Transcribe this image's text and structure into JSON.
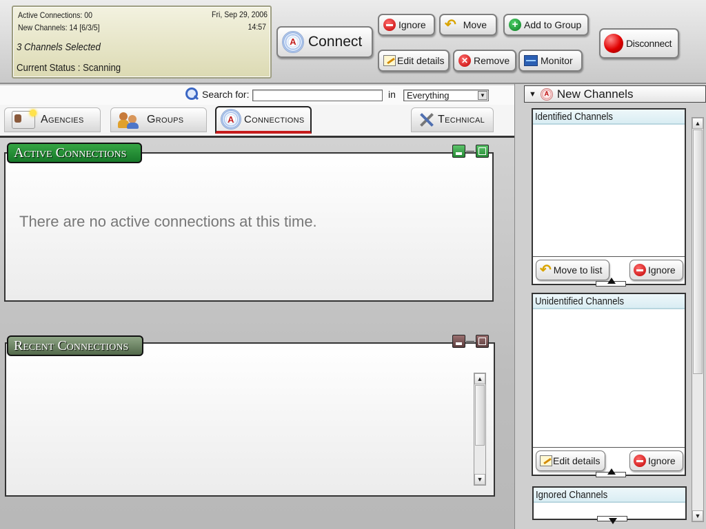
{
  "status": {
    "active_connections": "Active Connections: 00",
    "new_channels": "New Channels: 14 [6/3/5]",
    "date": "Fri, Sep 29, 2006",
    "time": "14:57",
    "channels_selected": "3 Channels Selected",
    "current_status": "Current Status : Scanning"
  },
  "toolbar": {
    "connect": "Connect",
    "ignore": "Ignore",
    "move": "Move",
    "add_to_group": "Add to Group",
    "edit_details": "Edit details",
    "remove": "Remove",
    "monitor": "Monitor",
    "disconnect": "Disconnect"
  },
  "search": {
    "label": "Search for:",
    "value": "",
    "in_label": "in",
    "scope": "Everything"
  },
  "tabs": [
    {
      "label": "Agencies",
      "icon": "id-card-icon"
    },
    {
      "label": "Groups",
      "icon": "people-icon"
    },
    {
      "label": "Connections",
      "icon": "antenna-icon",
      "active": true
    },
    {
      "label": "Technical",
      "icon": "tools-icon"
    }
  ],
  "active_connections": {
    "title": "Active Connections",
    "empty_message": "There are no active connections at this time.",
    "accent": "#1f8f2f"
  },
  "recent_connections": {
    "title": "Recent Connections",
    "accent": "#5a7a52"
  },
  "new_channels": {
    "title": "New Channels",
    "identified": {
      "title": "Identified Channels",
      "move_to_list": "Move to list",
      "ignore": "Ignore"
    },
    "unidentified": {
      "title": "Unidentified Channels",
      "edit_details": "Edit details",
      "ignore": "Ignore"
    },
    "ignored": {
      "title": "Ignored Channels"
    }
  },
  "colors": {
    "status_bg": "#e6e4c4",
    "active_tab_accent": "#c61b1b",
    "section_header_bg": "#d9edf3"
  }
}
